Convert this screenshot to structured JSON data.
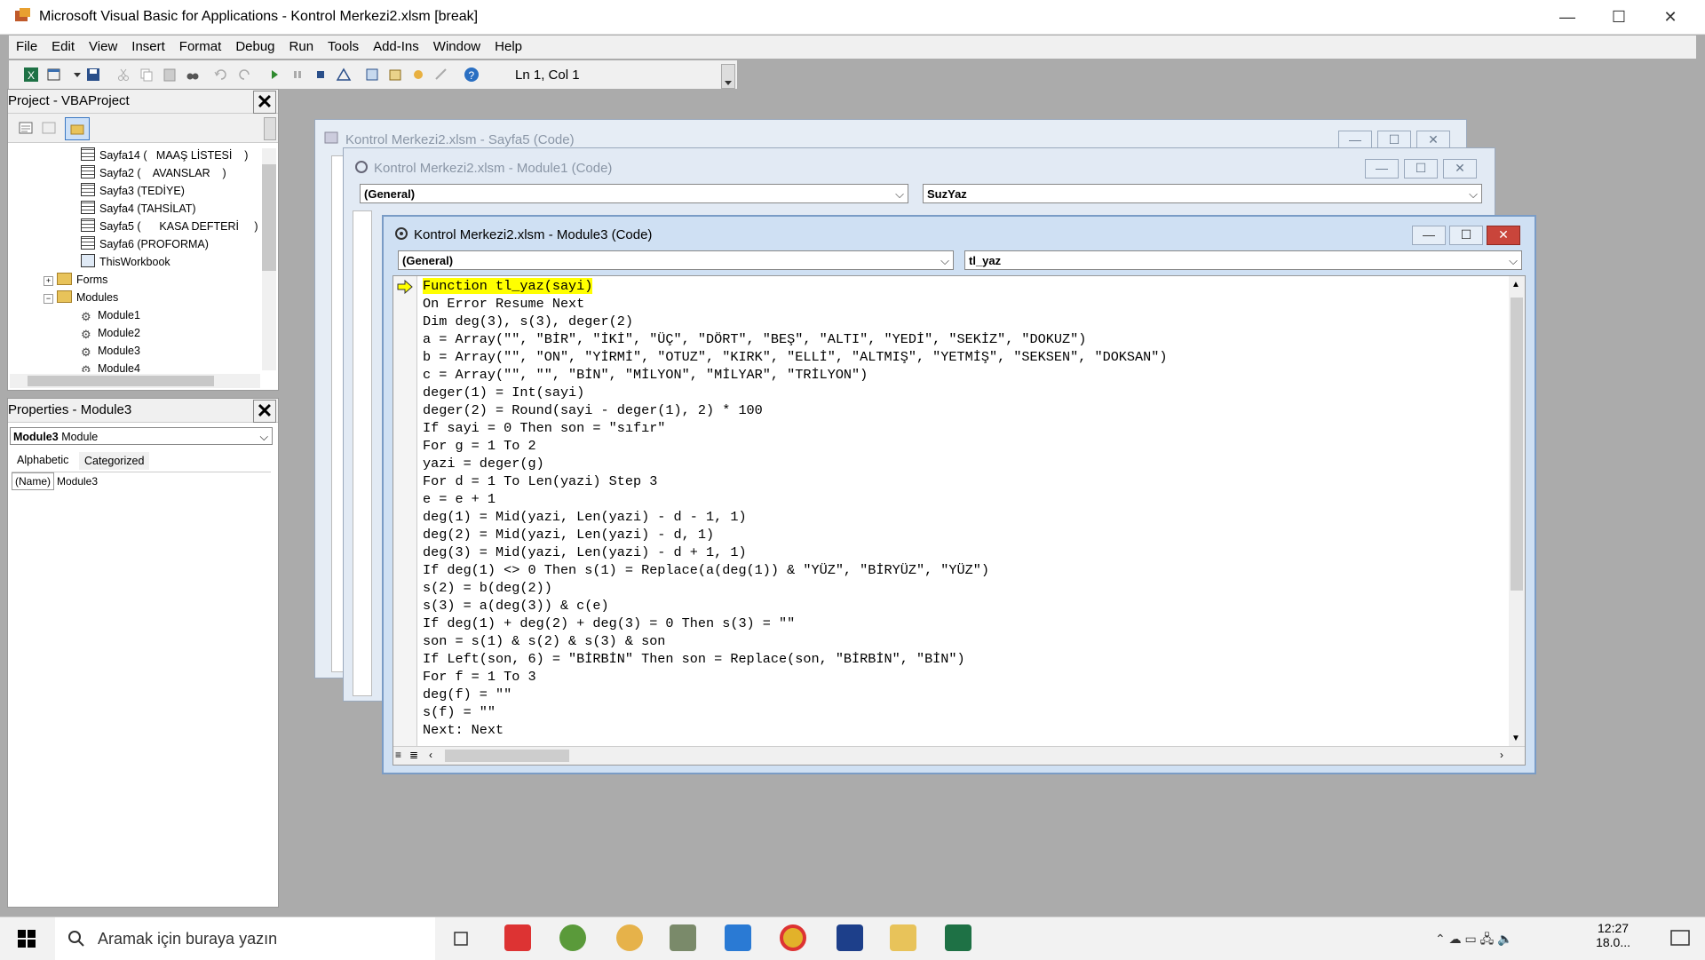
{
  "window": {
    "title": "Microsoft Visual Basic for Applications - Kontrol Merkezi2.xlsm [break]"
  },
  "menu": [
    "File",
    "Edit",
    "View",
    "Insert",
    "Format",
    "Debug",
    "Run",
    "Tools",
    "Add-Ins",
    "Window",
    "Help"
  ],
  "toolbar": {
    "position": "Ln 1, Col 1"
  },
  "project_panel": {
    "title": "Project - VBAProject",
    "items": [
      {
        "label": "Sayfa14 (   MAAŞ LİSTESİ    )",
        "icon": "sheet-icon"
      },
      {
        "label": "Sayfa2 (    AVANSLAR    )",
        "icon": "sheet-icon"
      },
      {
        "label": "Sayfa3 (TEDİYE)",
        "icon": "sheet-icon"
      },
      {
        "label": "Sayfa4 (TAHSİLAT)",
        "icon": "sheet-icon"
      },
      {
        "label": "Sayfa5 (      KASA DEFTERİ     )",
        "icon": "sheet-icon"
      },
      {
        "label": "Sayfa6 (PROFORMA)",
        "icon": "sheet-icon"
      },
      {
        "label": "ThisWorkbook",
        "icon": "workbook-icon"
      },
      {
        "label": "Forms",
        "icon": "folder-icon"
      },
      {
        "label": "Modules",
        "icon": "folder-icon"
      },
      {
        "label": "Module1",
        "icon": "module-icon"
      },
      {
        "label": "Module2",
        "icon": "module-icon"
      },
      {
        "label": "Module3",
        "icon": "module-icon"
      },
      {
        "label": "Module4",
        "icon": "module-icon"
      }
    ]
  },
  "properties_panel": {
    "title": "Properties - Module3",
    "object_name": "Module3",
    "object_type": "Module",
    "tabs": [
      "Alphabetic",
      "Categorized"
    ],
    "prop_name": "(Name)",
    "prop_value": "Module3"
  },
  "code_windows": {
    "sayfa5": {
      "title": "Kontrol Merkezi2.xlsm - Sayfa5 (Code)"
    },
    "module1": {
      "title": "Kontrol Merkezi2.xlsm - Module1 (Code)",
      "object": "(General)",
      "procedure": "SuzYaz"
    },
    "module3": {
      "title": "Kontrol Merkezi2.xlsm - Module3 (Code)",
      "object": "(General)",
      "procedure": "tl_yaz"
    }
  },
  "code_lines": [
    "Function tl_yaz(sayi)",
    "On Error Resume Next",
    "Dim deg(3), s(3), deger(2)",
    "a = Array(\"\", \"BİR\", \"İKİ\", \"ÜÇ\", \"DÖRT\", \"BEŞ\", \"ALTI\", \"YEDİ\", \"SEKİZ\", \"DOKUZ\")",
    "b = Array(\"\", \"ON\", \"YİRMİ\", \"OTUZ\", \"KIRK\", \"ELLİ\", \"ALTMIŞ\", \"YETMİŞ\", \"SEKSEN\", \"DOKSAN\")",
    "c = Array(\"\", \"\", \"BİN\", \"MİLYON\", \"MİLYAR\", \"TRİLYON\")",
    "deger(1) = Int(sayi)",
    "deger(2) = Round(sayi - deger(1), 2) * 100",
    "If sayi = 0 Then son = \"sıfır\"",
    "For g = 1 To 2",
    "yazi = deger(g)",
    "For d = 1 To Len(yazi) Step 3",
    "e = e + 1",
    "deg(1) = Mid(yazi, Len(yazi) - d - 1, 1)",
    "deg(2) = Mid(yazi, Len(yazi) - d, 1)",
    "deg(3) = Mid(yazi, Len(yazi) - d + 1, 1)",
    "If deg(1) <> 0 Then s(1) = Replace(a(deg(1)) & \"YÜZ\", \"BİRYÜZ\", \"YÜZ\")",
    "s(2) = b(deg(2))",
    "s(3) = a(deg(3)) & c(e)",
    "If deg(1) + deg(2) + deg(3) = 0 Then s(3) = \"\"",
    "son = s(1) & s(2) & s(3) & son",
    "If Left(son, 6) = \"BİRBİN\" Then son = Replace(son, \"BİRBİN\", \"BİN\")",
    "For f = 1 To 3",
    "deg(f) = \"\"",
    "s(f) = \"\"",
    "Next: Next"
  ],
  "taskbar": {
    "search_placeholder": "Aramak için buraya yazın",
    "time": "12:27",
    "date": "18.0..."
  },
  "colors": {
    "highlight": "#ffff00",
    "title_active": "#cfe0f3",
    "close_red": "#c9453b"
  }
}
